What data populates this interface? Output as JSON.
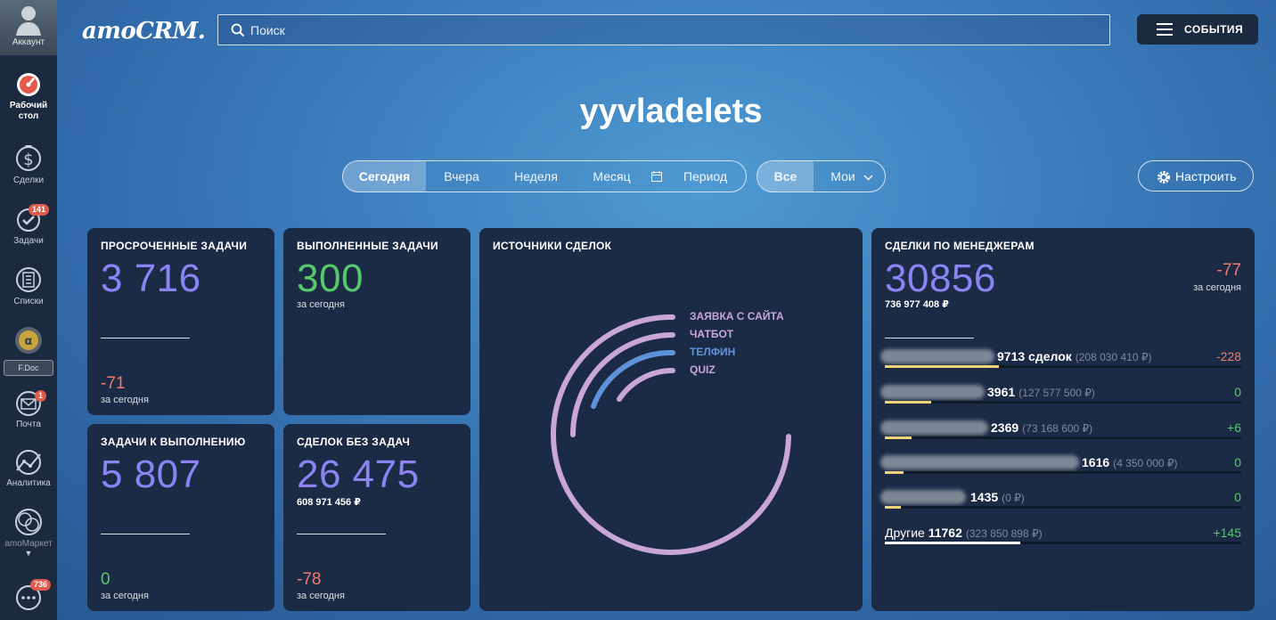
{
  "sidebar": {
    "account_label": "Аккаунт",
    "items": [
      {
        "label": "Рабочий стол",
        "icon": "dashboard-icon"
      },
      {
        "label": "Сделки",
        "icon": "dollar-icon"
      },
      {
        "label": "Задачи",
        "icon": "check-icon",
        "badge": "141"
      },
      {
        "label": "Списки",
        "icon": "list-icon"
      },
      {
        "label": "F.Doc",
        "icon": "fdoc-icon"
      },
      {
        "label": "Почта",
        "icon": "mail-icon",
        "badge": "1"
      },
      {
        "label": "Аналитика",
        "icon": "analytics-icon"
      },
      {
        "label": "amoМаркет",
        "icon": "market-icon"
      },
      {
        "label": "",
        "icon": "chat-icon",
        "badge": "736"
      }
    ]
  },
  "header": {
    "logo": "amoCRM.",
    "search_placeholder": "Поиск",
    "events_label": "СОБЫТИЯ"
  },
  "title": "yyvladelets",
  "period": {
    "options": [
      "Сегодня",
      "Вчера",
      "Неделя",
      "Месяц",
      "Период"
    ],
    "selected": "Сегодня"
  },
  "scope": {
    "options": [
      "Все",
      "Мои"
    ],
    "selected": "Все"
  },
  "settings_label": "Настроить",
  "widgets": {
    "overdue": {
      "title": "ПРОСРОЧЕННЫЕ ЗАДАЧИ",
      "value": "3 716",
      "delta": "-71",
      "delta_label": "за сегодня"
    },
    "done": {
      "title": "ВЫПОЛНЕННЫЕ ЗАДАЧИ",
      "value": "300",
      "sub": "за сегодня"
    },
    "todo": {
      "title": "ЗАДАЧИ К ВЫПОЛНЕНИЮ",
      "value": "5 807",
      "delta": "0",
      "delta_label": "за сегодня"
    },
    "no_tasks": {
      "title": "СДЕЛОК БЕЗ ЗАДАЧ",
      "value": "26 475",
      "sum": "608 971 456 ₽",
      "delta": "-78",
      "delta_label": "за сегодня"
    },
    "sources": {
      "title": "ИСТОЧНИКИ СДЕЛОК",
      "legend": [
        {
          "name": "ЗАЯВКА С САЙТА",
          "color": "#c9a6d6"
        },
        {
          "name": "ЧАТБОТ",
          "color": "#c9a6d6"
        },
        {
          "name": "ТЕЛФИН",
          "color": "#5e93d9"
        },
        {
          "name": "QUIZ",
          "color": "#c9a6d6"
        }
      ]
    },
    "managers": {
      "title": "СДЕЛКИ ПО МЕНЕДЖЕРАМ",
      "value": "30856",
      "sum": "736 977 408 ₽",
      "delta": "-77",
      "delta_label": "за сегодня",
      "rows": [
        {
          "name": "",
          "count": "9713 сделок",
          "amount": "(208 030 410 ₽)",
          "change": "-228",
          "change_color": "red",
          "fill": 0.32
        },
        {
          "name": "",
          "count": "3961",
          "amount": "(127 577 500 ₽)",
          "change": "0",
          "change_color": "green",
          "fill": 0.13
        },
        {
          "name": "",
          "count": "2369",
          "amount": "(73 168 600 ₽)",
          "change": "+6",
          "change_color": "green",
          "fill": 0.08
        },
        {
          "name": "",
          "count": "1616",
          "amount": "(4 350 000 ₽)",
          "change": "0",
          "change_color": "green",
          "fill": 0.055
        },
        {
          "name": "",
          "count": "1435",
          "amount": "(0 ₽)",
          "change": "0",
          "change_color": "green",
          "fill": 0.05
        },
        {
          "name": "Другие",
          "count": "11762",
          "amount": "(323 850 898 ₽)",
          "change": "+145",
          "change_color": "green",
          "fill": 0.38
        }
      ]
    }
  }
}
